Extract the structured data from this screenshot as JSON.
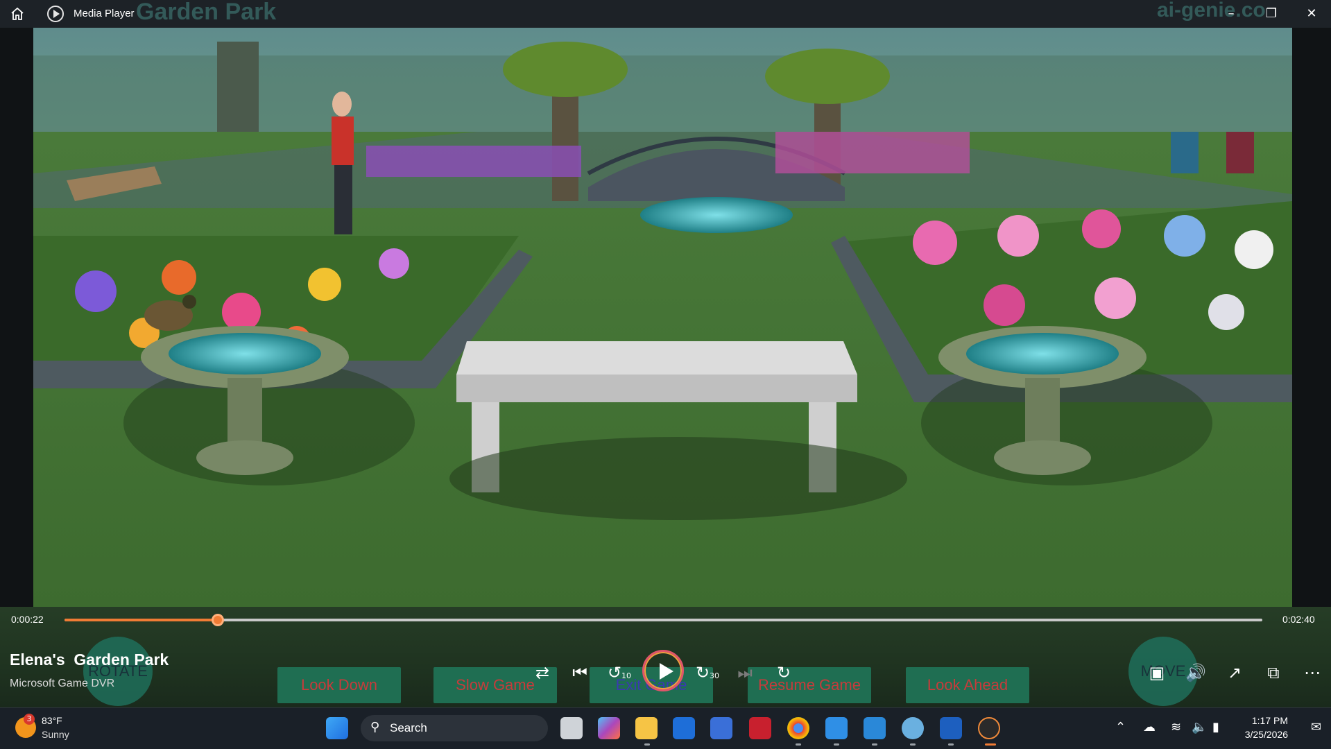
{
  "window": {
    "app_title": "Media Player",
    "watermark_left": "Garden Park",
    "watermark_right": "ai-genie.co"
  },
  "player": {
    "current_time": "0:00:22",
    "total_time": "0:02:40",
    "progress_fraction": 0.128,
    "track_title": "Elena's  Garden Park",
    "track_subtitle": "Microsoft Game DVR"
  },
  "game_overlay": {
    "rotate_label": "ROTATE",
    "move_label": "MOVE",
    "buttons": [
      "Look Down",
      "Slow Game",
      "Exit Game",
      "Resume  Game",
      "Look Ahead"
    ]
  },
  "controls": {
    "shuffle": "shuffle-icon",
    "previous": "previous-icon",
    "rewind_label": "10",
    "play": "play-icon",
    "forward_label": "30",
    "next": "next-icon",
    "repeat": "repeat-icon"
  },
  "taskbar": {
    "weather_badge": "3",
    "weather_temp": "83°F",
    "weather_condition": "Sunny",
    "search_placeholder": "Search",
    "clock_time": "1:17 PM",
    "clock_date": "3/25/2026"
  },
  "colors": {
    "accent_orange": "#f07c35",
    "game_button_bg": "#1f6e52",
    "game_button_text": "#c73b3b"
  }
}
